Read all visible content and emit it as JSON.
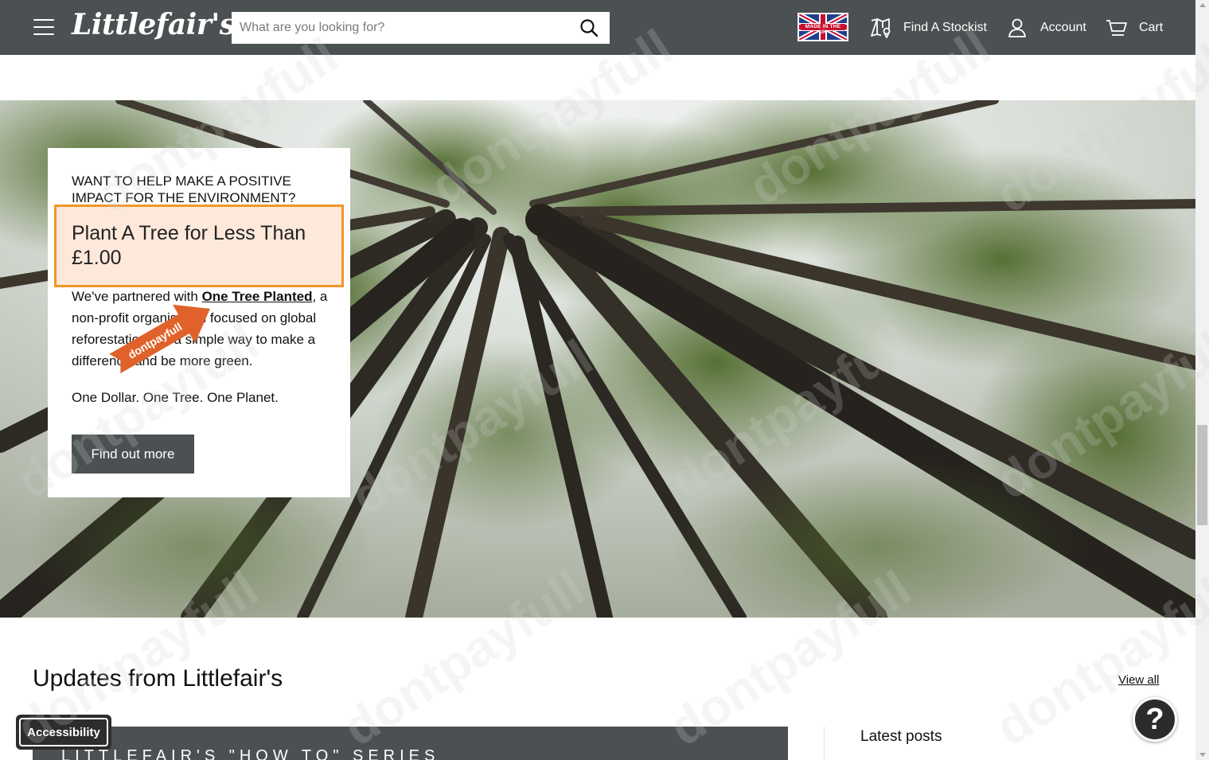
{
  "header": {
    "logo": "Littlefair's",
    "search_placeholder": "What are you looking for?",
    "flag_label": "MADE IN THE UK",
    "nav": {
      "stockist": "Find A Stockist",
      "account": "Account",
      "cart": "Cart"
    }
  },
  "hero": {
    "eyebrow": "WANT TO HELP MAKE A POSITIVE IMPACT FOR THE ENVIRONMENT?",
    "title": "Plant A Tree for Less Than £1.00",
    "body_prefix": "We've partnered with ",
    "body_link": "One Tree Planted",
    "body_suffix": ", a non-profit organisation focused on global reforestation, for a simple way to make a difference and be more green.",
    "tagline": "One Dollar. One Tree. One Planet.",
    "cta": "Find out more",
    "arrow_label": "dontpayfull"
  },
  "updates": {
    "title": "Updates from Littlefair's",
    "view_all": "View all",
    "series": "LITTLEFAIR'S \"HOW TO\" SERIES",
    "latest": "Latest posts"
  },
  "widgets": {
    "accessibility": "Accessibility",
    "help": "?"
  },
  "watermark": "dontpayfull",
  "colors": {
    "header_bg": "#4b5152",
    "highlight_bg": "#fde8da",
    "highlight_border": "#f0962a",
    "arrow": "#e0622a"
  }
}
